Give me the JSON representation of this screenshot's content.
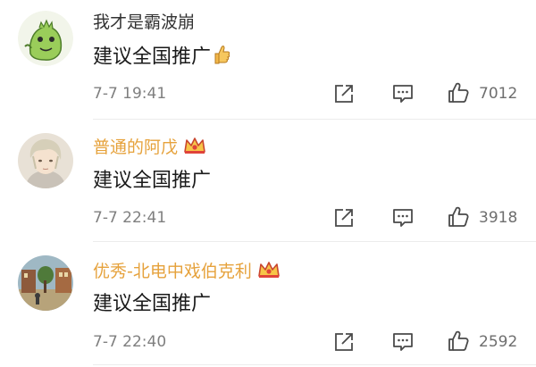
{
  "comments": [
    {
      "username": "我才是霸波崩",
      "username_color": "#333333",
      "vip": false,
      "text": "建议全国推广",
      "has_thumb_emoji": true,
      "time": "7-7 19:41",
      "likes": "7012",
      "avatar": "green-dinosaur-avatar"
    },
    {
      "username": "普通的阿戊",
      "username_color": "#e6a23c",
      "vip": true,
      "text": "建议全国推广",
      "has_thumb_emoji": false,
      "time": "7-7 22:41",
      "likes": "3918",
      "avatar": "anime-boy-avatar"
    },
    {
      "username": "优秀-北电中戏伯克利",
      "username_color": "#e6a23c",
      "vip": true,
      "text": "建议全国推广",
      "has_thumb_emoji": false,
      "time": "7-7 22:40",
      "likes": "2592",
      "avatar": "street-scene-avatar"
    }
  ],
  "icons": {
    "repost": "share-icon",
    "reply": "comment-icon",
    "like": "thumbs-up-icon",
    "vip": "crown-icon"
  },
  "colors": {
    "icon": "#4a4a4a",
    "time": "#7f7f7f",
    "vip_accent": "#e6a23c"
  }
}
